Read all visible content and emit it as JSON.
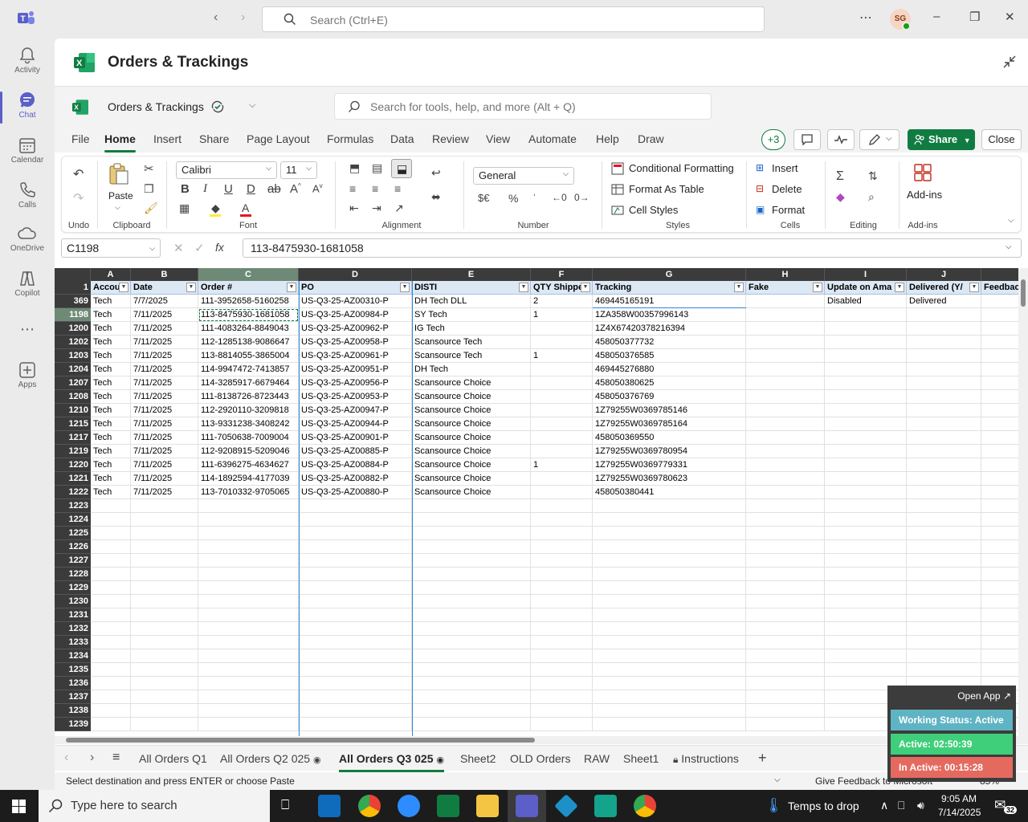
{
  "teams": {
    "search_placeholder": "Search (Ctrl+E)",
    "avatar_initials": "SG",
    "rail": [
      {
        "label": "Activity"
      },
      {
        "label": "Chat"
      },
      {
        "label": "Calendar"
      },
      {
        "label": "Calls"
      },
      {
        "label": "OneDrive"
      },
      {
        "label": "Copilot"
      },
      {
        "label": "Apps"
      }
    ]
  },
  "app": {
    "title": "Orders & Trackings",
    "doc_name": "Orders & Trackings",
    "tool_search_placeholder": "Search for tools, help, and more (Alt + Q)"
  },
  "menu": {
    "tabs": [
      "File",
      "Home",
      "Insert",
      "Share",
      "Page Layout",
      "Formulas",
      "Data",
      "Review",
      "View",
      "Automate",
      "Help",
      "Draw"
    ],
    "active": "Home",
    "plus_count": "+3",
    "share_label": "Share",
    "close_label": "Close"
  },
  "ribbon": {
    "undo_label": "Undo",
    "clipboard_label": "Clipboard",
    "paste_label": "Paste",
    "font_name": "Calibri",
    "font_size": "11",
    "font_label": "Font",
    "alignment_label": "Alignment",
    "number_format": "General",
    "number_label": "Number",
    "conditional_formatting": "Conditional Formatting",
    "format_as_table": "Format As Table",
    "cell_styles": "Cell Styles",
    "styles_label": "Styles",
    "insert": "Insert",
    "delete": "Delete",
    "format": "Format",
    "cells_label": "Cells",
    "editing_label": "Editing",
    "addins": "Add-ins",
    "addins_label": "Add-ins"
  },
  "formula_bar": {
    "name_box": "C1198",
    "formula": "113-8475930-1681058"
  },
  "grid": {
    "columns": [
      "A",
      "B",
      "C",
      "D",
      "E",
      "F",
      "G",
      "H",
      "I",
      "J"
    ],
    "headers": [
      "Accou",
      "Date",
      "Order #",
      "PO",
      "DISTI",
      "QTY Shippe",
      "Tracking",
      "Fake",
      "Update on Ama",
      "Delivered (Y/",
      "Feedbac"
    ],
    "rows": [
      {
        "num": "369",
        "cells": [
          "Tech",
          "7/7/2025",
          "111-3952658-5160258",
          "US-Q3-25-AZ00310-P",
          "DH Tech DLL",
          "2",
          "469445165191",
          "",
          "Disabled",
          "Delivered"
        ]
      },
      {
        "num": "1198",
        "cells": [
          "Tech",
          "7/11/2025",
          "113-8475930-1681058",
          "US-Q3-25-AZ00984-P",
          "SY Tech",
          "1",
          "1ZA358W00357996143",
          "",
          "",
          ""
        ]
      },
      {
        "num": "1200",
        "cells": [
          "Tech",
          "7/11/2025",
          "111-4083264-8849043",
          "US-Q3-25-AZ00962-P",
          "IG Tech",
          "",
          "1Z4X67420378216394",
          "",
          "",
          ""
        ]
      },
      {
        "num": "1202",
        "cells": [
          "Tech",
          "7/11/2025",
          "112-1285138-9086647",
          "US-Q3-25-AZ00958-P",
          "Scansource Tech",
          "",
          "458050377732",
          "",
          "",
          ""
        ]
      },
      {
        "num": "1203",
        "cells": [
          "Tech",
          "7/11/2025",
          "113-8814055-3865004",
          "US-Q3-25-AZ00961-P",
          "Scansource Tech",
          "1",
          "458050376585",
          "",
          "",
          ""
        ]
      },
      {
        "num": "1204",
        "cells": [
          "Tech",
          "7/11/2025",
          "114-9947472-7413857",
          "US-Q3-25-AZ00951-P",
          "DH Tech",
          "",
          "469445276880",
          "",
          "",
          ""
        ]
      },
      {
        "num": "1207",
        "cells": [
          "Tech",
          "7/11/2025",
          "114-3285917-6679464",
          "US-Q3-25-AZ00956-P",
          "Scansource Choice",
          "",
          "458050380625",
          "",
          "",
          ""
        ]
      },
      {
        "num": "1208",
        "cells": [
          "Tech",
          "7/11/2025",
          "111-8138726-8723443",
          "US-Q3-25-AZ00953-P",
          "Scansource Choice",
          "",
          "458050376769",
          "",
          "",
          ""
        ]
      },
      {
        "num": "1210",
        "cells": [
          "Tech",
          "7/11/2025",
          "112-2920110-3209818",
          "US-Q3-25-AZ00947-P",
          "Scansource Choice",
          "",
          "1Z79255W0369785146",
          "",
          "",
          ""
        ]
      },
      {
        "num": "1215",
        "cells": [
          "Tech",
          "7/11/2025",
          "113-9331238-3408242",
          "US-Q3-25-AZ00944-P",
          "Scansource Choice",
          "",
          "1Z79255W0369785164",
          "",
          "",
          ""
        ]
      },
      {
        "num": "1217",
        "cells": [
          "Tech",
          "7/11/2025",
          "111-7050638-7009004",
          "US-Q3-25-AZ00901-P",
          "Scansource Choice",
          "",
          "458050369550",
          "",
          "",
          ""
        ]
      },
      {
        "num": "1219",
        "cells": [
          "Tech",
          "7/11/2025",
          "112-9208915-5209046",
          "US-Q3-25-AZ00885-P",
          "Scansource Choice",
          "",
          "1Z79255W0369780954",
          "",
          "",
          ""
        ]
      },
      {
        "num": "1220",
        "cells": [
          "Tech",
          "7/11/2025",
          "111-6396275-4634627",
          "US-Q3-25-AZ00884-P",
          "Scansource Choice",
          "1",
          "1Z79255W0369779331",
          "",
          "",
          ""
        ]
      },
      {
        "num": "1221",
        "cells": [
          "Tech",
          "7/11/2025",
          "114-1892594-4177039",
          "US-Q3-25-AZ00882-P",
          "Scansource Choice",
          "",
          "1Z79255W0369780623",
          "",
          "",
          ""
        ]
      },
      {
        "num": "1222",
        "cells": [
          "Tech",
          "7/11/2025",
          "113-7010332-9705065",
          "US-Q3-25-AZ00880-P",
          "Scansource Choice",
          "",
          "458050380441",
          "",
          "",
          ""
        ]
      }
    ],
    "empty_rows": [
      "1223",
      "1224",
      "1225",
      "1226",
      "1227",
      "1228",
      "1229",
      "1230",
      "1231",
      "1232",
      "1233",
      "1234",
      "1235",
      "1236",
      "1237",
      "1238",
      "1239"
    ]
  },
  "sheets": {
    "tabs": [
      "All Orders Q1",
      "All Orders Q2 025",
      "All Orders Q3 025",
      "Sheet2",
      "OLD Orders",
      "RAW",
      "Sheet1",
      "Instructions"
    ],
    "active": "All Orders Q3 025"
  },
  "status": {
    "message": "Select destination and press ENTER or choose Paste",
    "feedback": "Give Feedback to Microsoft",
    "zoom": "85%"
  },
  "widget": {
    "open_app": "Open App",
    "working_status": "Working Status: Active",
    "active": "Active: 02:50:39",
    "inactive": "In Active: 00:15:28",
    "colors": {
      "working": "#5fb4c4",
      "active": "#3fcf7a",
      "inactive": "#e46a5f"
    }
  },
  "taskbar": {
    "search_placeholder": "Type here to search",
    "weather": "Temps to drop",
    "time": "9:05 AM",
    "date": "7/14/2025",
    "notifications": "32"
  },
  "colors": {
    "excel_green": "#107c41",
    "teams_purple": "#5b5fc7"
  }
}
